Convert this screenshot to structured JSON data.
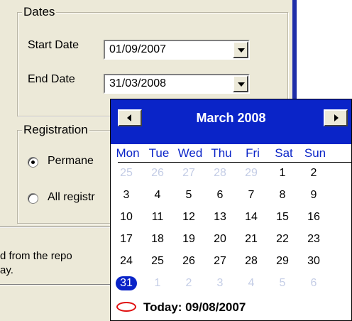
{
  "dates_group": {
    "title": "Dates"
  },
  "start_date": {
    "label": "Start Date",
    "value": "01/09/2007"
  },
  "end_date": {
    "label": "End Date",
    "value": "31/03/2008"
  },
  "registration_group": {
    "title": "Registration",
    "options": [
      {
        "label": "Permane",
        "selected": true
      },
      {
        "label": "All registr",
        "selected": false
      }
    ]
  },
  "info_text": {
    "line1": "d from the repo",
    "line2": "ay."
  },
  "calendar": {
    "month_title": "March 2008",
    "days_of_week": [
      "Mon",
      "Tue",
      "Wed",
      "Thu",
      "Fri",
      "Sat",
      "Sun"
    ],
    "weeks": [
      [
        {
          "d": "25",
          "dim": true
        },
        {
          "d": "26",
          "dim": true
        },
        {
          "d": "27",
          "dim": true
        },
        {
          "d": "28",
          "dim": true
        },
        {
          "d": "29",
          "dim": true
        },
        {
          "d": "1"
        },
        {
          "d": "2"
        }
      ],
      [
        {
          "d": "3"
        },
        {
          "d": "4"
        },
        {
          "d": "5"
        },
        {
          "d": "6"
        },
        {
          "d": "7"
        },
        {
          "d": "8"
        },
        {
          "d": "9"
        }
      ],
      [
        {
          "d": "10"
        },
        {
          "d": "11"
        },
        {
          "d": "12"
        },
        {
          "d": "13"
        },
        {
          "d": "14"
        },
        {
          "d": "15"
        },
        {
          "d": "16"
        }
      ],
      [
        {
          "d": "17"
        },
        {
          "d": "18"
        },
        {
          "d": "19"
        },
        {
          "d": "20"
        },
        {
          "d": "21"
        },
        {
          "d": "22"
        },
        {
          "d": "23"
        }
      ],
      [
        {
          "d": "24"
        },
        {
          "d": "25"
        },
        {
          "d": "26"
        },
        {
          "d": "27"
        },
        {
          "d": "28"
        },
        {
          "d": "29"
        },
        {
          "d": "30"
        }
      ],
      [
        {
          "d": "31",
          "selected": true
        },
        {
          "d": "1",
          "dim": true
        },
        {
          "d": "2",
          "dim": true
        },
        {
          "d": "3",
          "dim": true
        },
        {
          "d": "4",
          "dim": true
        },
        {
          "d": "5",
          "dim": true
        },
        {
          "d": "6",
          "dim": true
        }
      ]
    ],
    "today_label": "Today: 09/08/2007"
  },
  "colors": {
    "header_blue": "#0a24c8",
    "dim_day": "#c4cde6",
    "today_red": "#e01010"
  }
}
